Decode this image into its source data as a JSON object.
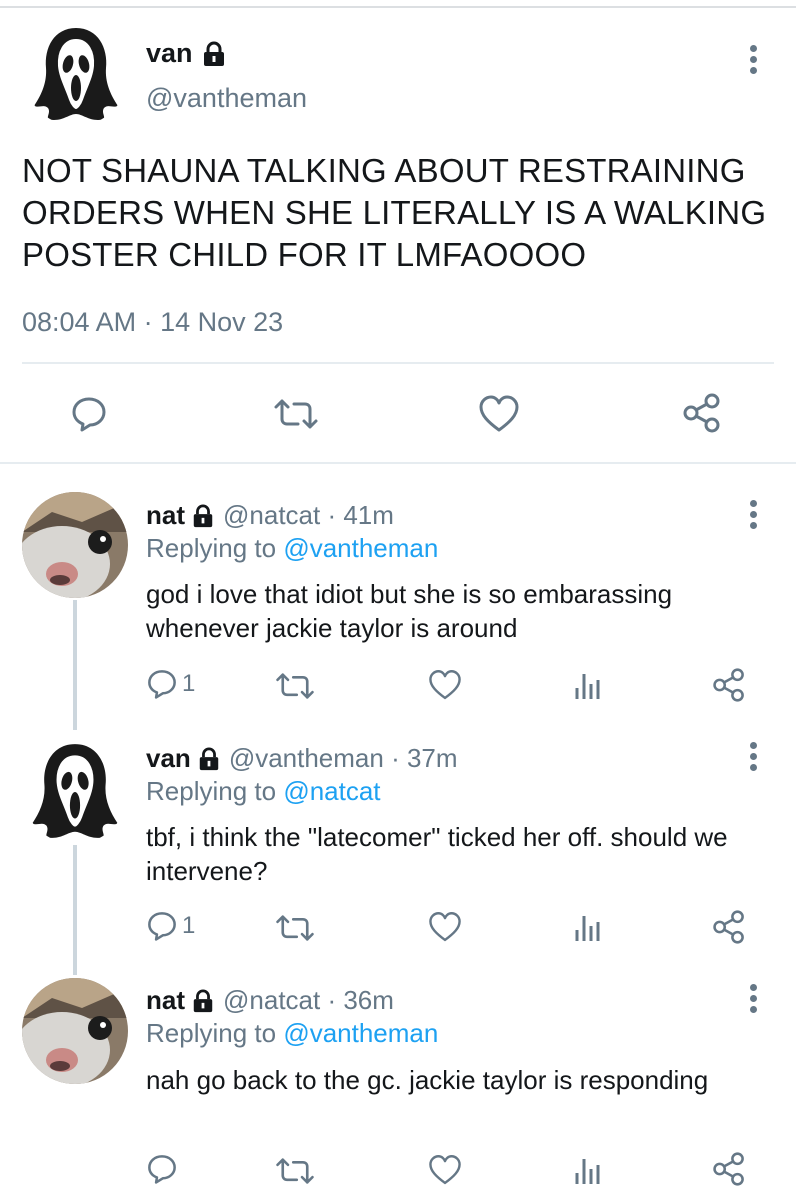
{
  "main_tweet": {
    "name": "van",
    "handle": "@vantheman",
    "text": "NOT SHAUNA TALKING ABOUT RESTRAINING ORDERS WHEN SHE LITERALLY IS A WALKING POSTER CHILD FOR IT LMFAOOOO",
    "timestamp": "08:04 AM · 14 Nov 23",
    "avatar_icon": "ghostface-mask-icon"
  },
  "replies": [
    {
      "name": "nat",
      "meta": "@natcat · 41m",
      "replying_prefix": "Replying to",
      "replying_to": "@vantheman",
      "text": "god i love that idiot but she is so embarassing whenever jackie taylor is around",
      "reply_count": "1",
      "avatar_icon": "cat-photo-avatar"
    },
    {
      "name": "van",
      "meta": "@vantheman · 37m",
      "replying_prefix": "Replying to",
      "replying_to": "@natcat",
      "text": "tbf, i think the \"latecomer\" ticked her off. should we intervene?",
      "reply_count": "1",
      "avatar_icon": "ghostface-mask-icon"
    },
    {
      "name": "nat",
      "meta": "@natcat · 36m",
      "replying_prefix": "Replying to",
      "replying_to": "@vantheman",
      "text": "nah go back to the gc. jackie taylor is responding",
      "reply_count": "",
      "avatar_icon": "cat-photo-avatar"
    }
  ],
  "colors": {
    "text": "#14171a",
    "secondary": "#657786",
    "link": "#1da1f2",
    "separator": "#e6ecf0",
    "thread_line": "#ccd6dd"
  }
}
